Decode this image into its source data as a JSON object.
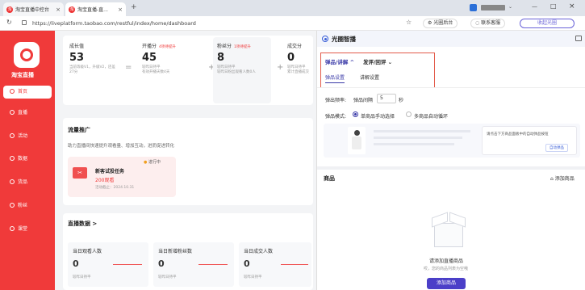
{
  "browser": {
    "tabs": [
      {
        "label": "淘宝直播中控台",
        "close": "×"
      },
      {
        "label": "淘宝直播-直...",
        "close": "×"
      }
    ],
    "new_tab": "+",
    "url": "https://liveplatform.taobao.com/restful/index/home/dashboard",
    "toolbar": {
      "guangquan_label": "光圈后台",
      "service_label": "联系客服",
      "button_label": "收起光圈"
    },
    "window_controls": [
      "—",
      "□",
      "×"
    ],
    "tab_icon_text": "淘"
  },
  "sidebar": {
    "logo_text": "淘宝直播",
    "items": [
      {
        "label": "首页",
        "active": true
      },
      {
        "label": "直播"
      },
      {
        "label": "活动"
      },
      {
        "label": "数据"
      },
      {
        "label": "货品"
      },
      {
        "label": "粉丝"
      },
      {
        "label": "课堂"
      }
    ]
  },
  "stats": [
    {
      "title": "成长值",
      "value": "53",
      "sub": "当前等级V1，升级V2，还差27分",
      "badge": ""
    },
    {
      "title": "开播分",
      "value": "45",
      "sub": "较昨日持平\n有效开播天数4天",
      "badge": "4项待提升"
    },
    {
      "title": "粉丝分",
      "value": "8",
      "sub": "较昨日持平\n较昨日粉丝观看人数0人",
      "badge": "1项待提升"
    },
    {
      "title": "成交分",
      "value": "0",
      "sub": "较昨日持平\n累计直播成交",
      "badge": ""
    }
  ],
  "stat_ops": [
    "=",
    "+",
    "+"
  ],
  "promo": {
    "title": "流量推广",
    "subtitle": "助力直播间快速提升观看量、增加互动，进而促进转化",
    "task": {
      "status": "进行中",
      "name": "新客试投任务",
      "reward": "200观看",
      "deadline": "活动截止：2024.10.31"
    }
  },
  "live_data": {
    "title": "直播数据 >",
    "metrics": [
      {
        "label": "当日观看人数",
        "value": "0",
        "sub": "较昨日持平"
      },
      {
        "label": "当日新增粉丝数",
        "value": "0",
        "sub": "较昨日持平"
      },
      {
        "label": "当日成交人数",
        "value": "0",
        "sub": "较昨日持平"
      }
    ]
  },
  "panel": {
    "title": "光圈智播",
    "menu": {
      "explain": "弹品/讲解",
      "replay": "发评/回评",
      "sub_tab_active": "弹品设置",
      "sub_tab": "讲解设置"
    },
    "freq_label": "弹出频率:",
    "interval_label": "弹品间隔",
    "interval_value": "5",
    "unit": "秒",
    "mode_label": "弹品模式:",
    "mode_options": [
      "单商品手动选择",
      "多商品自动循环"
    ],
    "hint": "请点击下方商品面板中的自动弹品按钮",
    "hint_btn": "自动弹品",
    "products_title": "商品",
    "add_product_link": "添加商品",
    "empty_title": "请添加直播商品",
    "empty_sub": "哎，您的商品列表为空哦",
    "add_button": "添加商品"
  },
  "colors": {
    "brand": "#f03a3a",
    "accent": "#e23a5a",
    "panel_header": "#f3f5fb",
    "frame": "#e35a4a"
  }
}
